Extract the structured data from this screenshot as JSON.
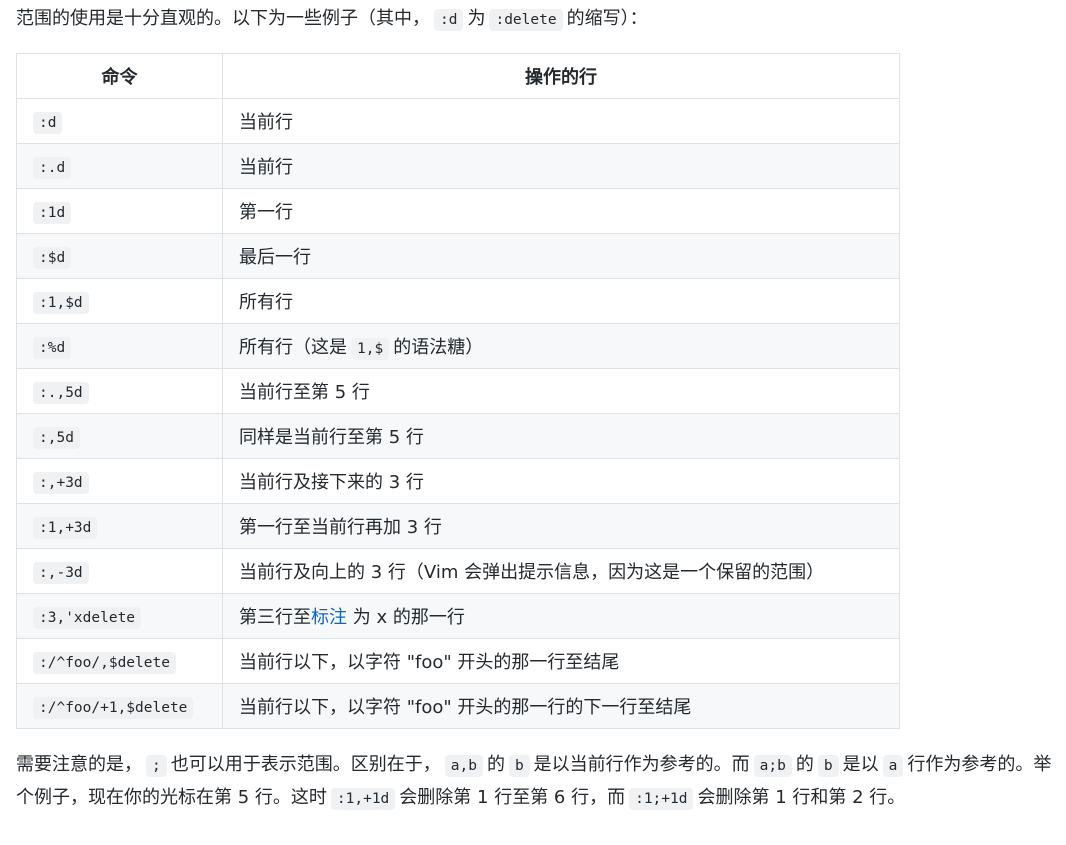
{
  "intro": {
    "p1": "范围的使用是十分直观的。以下为一些例子（其中，",
    "code1": ":d",
    "p2": "为",
    "code2": ":delete",
    "p3": "的缩写）："
  },
  "table": {
    "headers": [
      "命令",
      "操作的行"
    ],
    "rows": [
      {
        "cmd": ":d",
        "desc": "当前行"
      },
      {
        "cmd": ":.d",
        "desc": "当前行"
      },
      {
        "cmd": ":1d",
        "desc": "第一行"
      },
      {
        "cmd": ":$d",
        "desc": "最后一行"
      },
      {
        "cmd": ":1,$d",
        "desc": "所有行"
      },
      {
        "cmd": ":%d",
        "desc_a": "所有行（这是",
        "desc_code": "1,$",
        "desc_b": "的语法糖）"
      },
      {
        "cmd": ":.,5d",
        "desc": "当前行至第 5 行"
      },
      {
        "cmd": ":,5d",
        "desc": "同样是当前行至第 5 行"
      },
      {
        "cmd": ":,+3d",
        "desc": "当前行及接下来的 3 行"
      },
      {
        "cmd": ":1,+3d",
        "desc": "第一行至当前行再加 3 行"
      },
      {
        "cmd": ":,-3d",
        "desc": "当前行及向上的 3 行（Vim 会弹出提示信息，因为这是一个保留的范围）"
      },
      {
        "cmd": ":3,'xdelete",
        "desc_a": "第三行至",
        "desc_link": "标注",
        "desc_b": "为 x 的那一行"
      },
      {
        "cmd": ":/^foo/,$delete",
        "desc": "当前行以下，以字符 \"foo\" 开头的那一行至结尾"
      },
      {
        "cmd": ":/^foo/+1,$delete",
        "desc": "当前行以下，以字符 \"foo\" 开头的那一行的下一行至结尾"
      }
    ]
  },
  "outro": {
    "t1": "需要注意的是，",
    "c1": ";",
    "t2": "也可以用于表示范围。区别在于，",
    "c2": "a,b",
    "t3": "的",
    "c3": "b",
    "t4": "是以当前行作为参考的。而",
    "c4": "a;b",
    "t5": "的",
    "c5": "b",
    "t6": "是以",
    "c6": "a",
    "t7": "行作为参考的。举个例子，现在你的光标在第 5 行。这时",
    "c7": ":1,+1d",
    "t8": "会删除第 1 行至第 6 行，而",
    "c8": ":1;+1d",
    "t9": "会删除第 1 行和第 2 行。"
  },
  "colors": {
    "text": "#24292e",
    "code_bg": "#f0f1f3",
    "stripe_bg": "#f6f8fa",
    "border": "#dfe2e5",
    "link": "#0366d6"
  }
}
